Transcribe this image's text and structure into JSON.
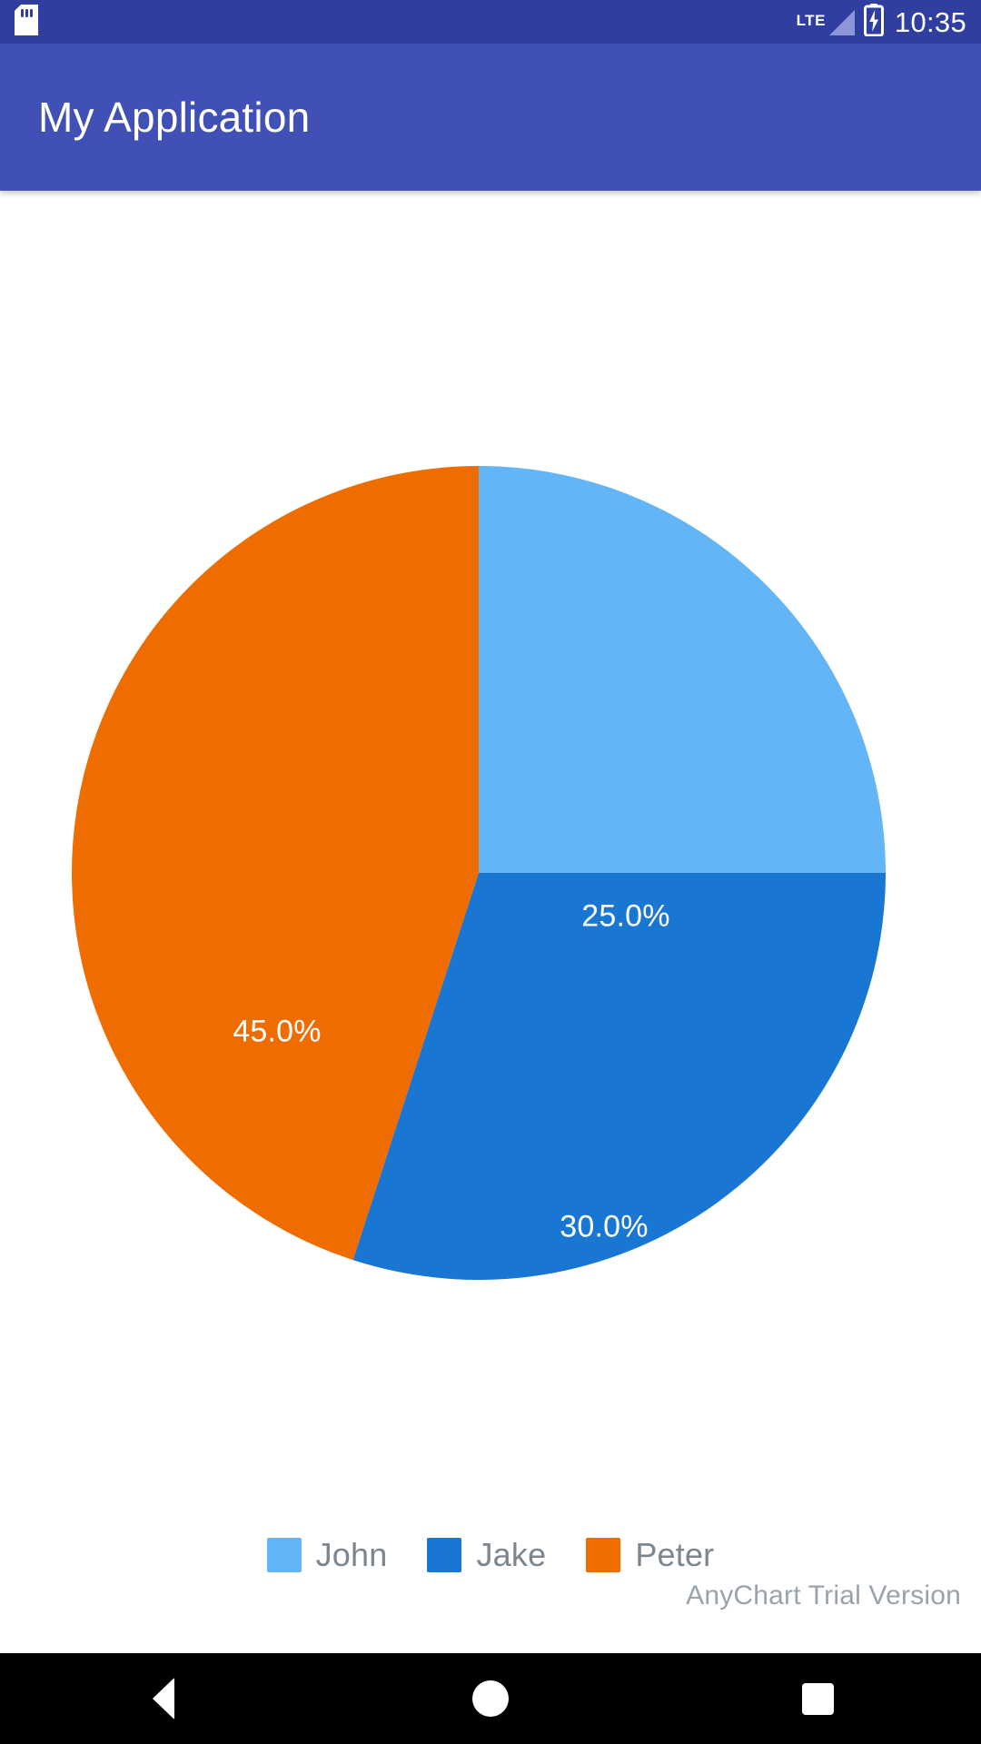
{
  "status_bar": {
    "time": "10:35",
    "network_label": "LTE",
    "icons": [
      "sd-card-icon",
      "signal-icon",
      "battery-charging-icon"
    ],
    "background_color": "#303F9F"
  },
  "app_bar": {
    "title": "My Application",
    "background_color": "#4150B4",
    "text_color": "#FFFFFF"
  },
  "chart_data": {
    "type": "pie",
    "title": "",
    "labels": [
      "John",
      "Jake",
      "Peter"
    ],
    "values": [
      25.0,
      30.0,
      45.0
    ],
    "value_labels": [
      "25.0%",
      "30.0%",
      "45.0%"
    ],
    "colors": [
      "#64B5F6",
      "#1976D2",
      "#EF6C00"
    ],
    "start_angle": 0,
    "direction": "clockwise",
    "legend_position": "bottom",
    "label_text_color": "#FFFFFF",
    "slices": [
      {
        "name": "John",
        "value": 25.0,
        "display": "25.0%",
        "color": "#64B5F6"
      },
      {
        "name": "Jake",
        "value": 30.0,
        "display": "30.0%",
        "color": "#1976D2"
      },
      {
        "name": "Peter",
        "value": 45.0,
        "display": "45.0%",
        "color": "#EF6C00"
      }
    ]
  },
  "legend": {
    "items": [
      {
        "label": "John",
        "color": "#64B5F6"
      },
      {
        "label": "Jake",
        "color": "#1976D2"
      },
      {
        "label": "Peter",
        "color": "#EF6C00"
      }
    ],
    "text_color": "#7c868e"
  },
  "watermark": {
    "text": "AnyChart Trial Version",
    "color": "#9aa3ab"
  },
  "nav_bar": {
    "background_color": "#000000",
    "buttons": [
      {
        "name": "back",
        "icon": "triangle-left-icon"
      },
      {
        "name": "home",
        "icon": "circle-icon"
      },
      {
        "name": "recent",
        "icon": "square-icon"
      }
    ]
  }
}
